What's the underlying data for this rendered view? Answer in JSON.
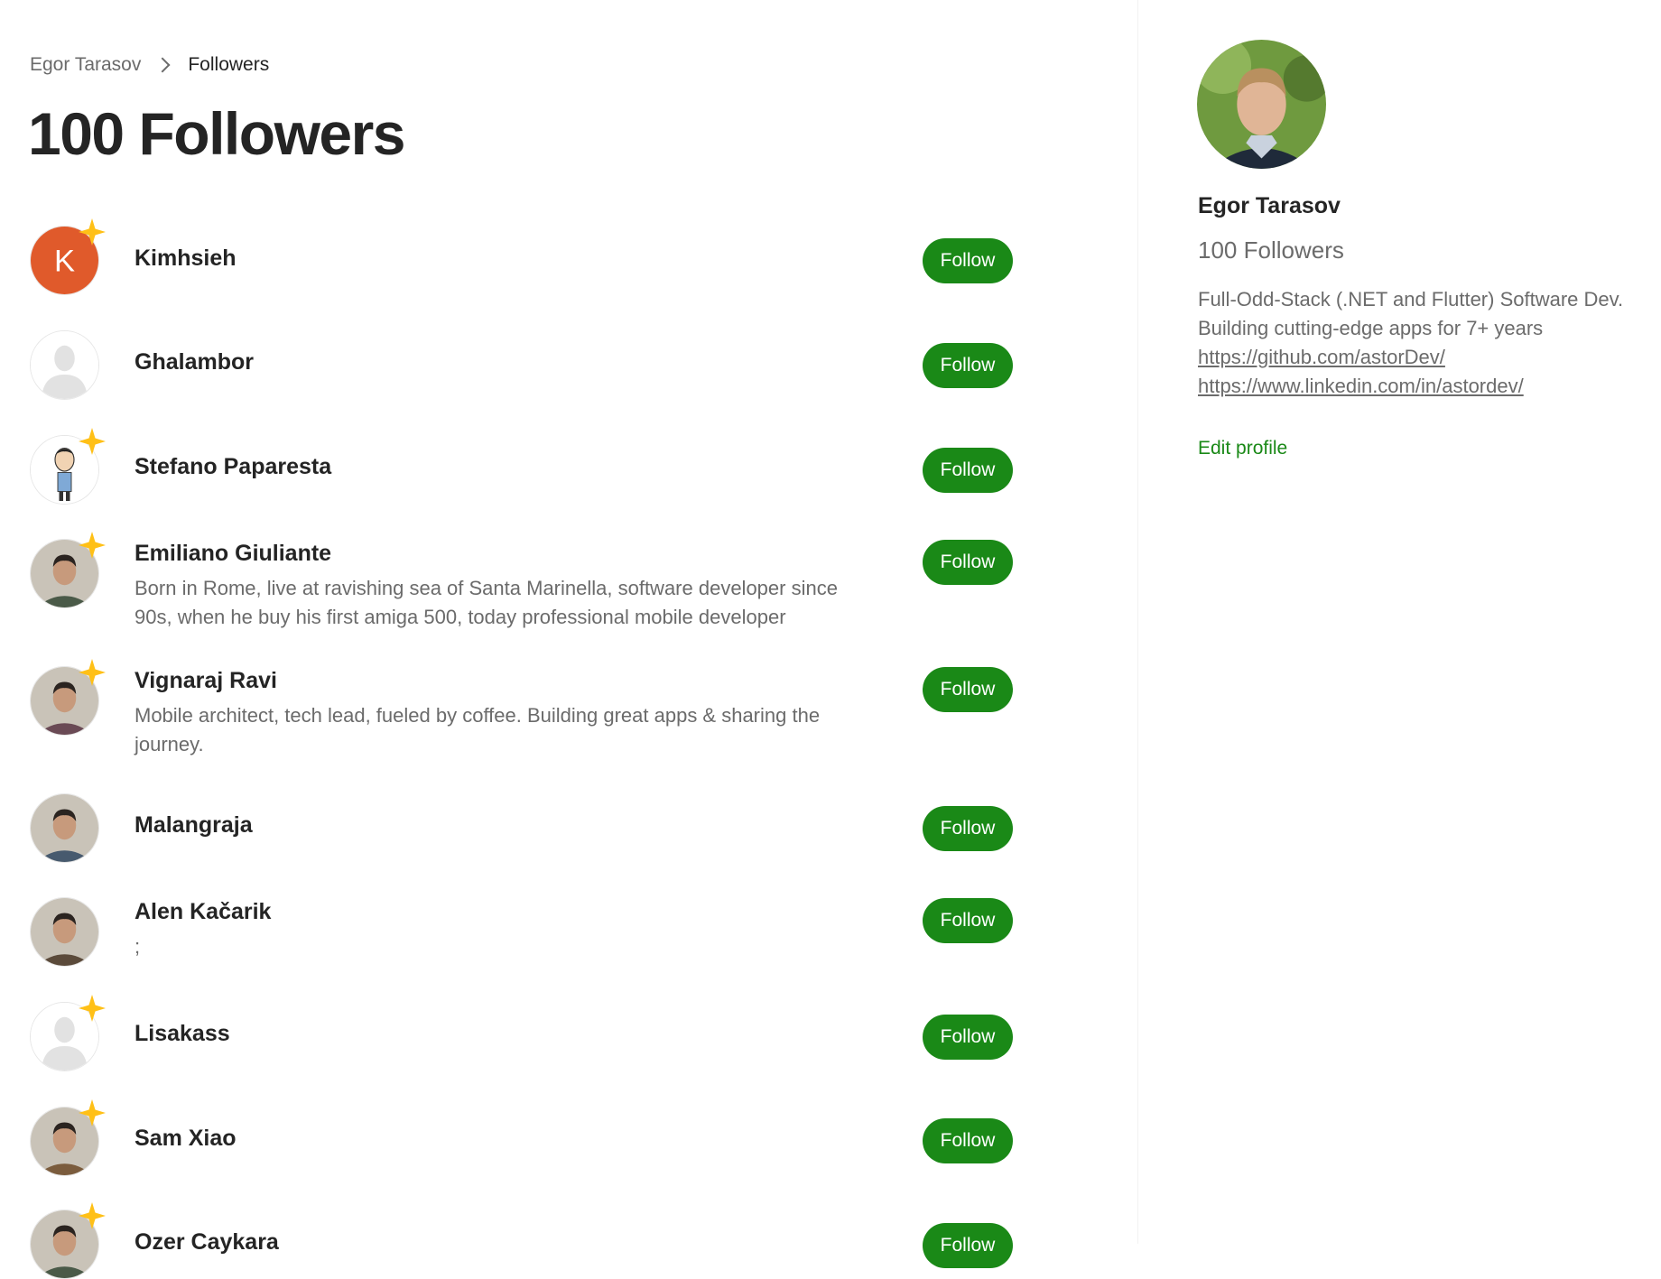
{
  "breadcrumb": {
    "parent": "Egor Tarasov",
    "current": "Followers"
  },
  "page_title": "100 Followers",
  "follow_label": "Follow",
  "followers": [
    {
      "name": "Kimhsieh",
      "bio": "",
      "avatar": "letter-avatar",
      "letter": "K",
      "avatar_color": "#e05a2b",
      "member": true
    },
    {
      "name": "Ghalambor",
      "bio": "",
      "avatar": "default-avatar",
      "member": false
    },
    {
      "name": "Stefano Paparesta",
      "bio": "",
      "avatar": "cartoon-avatar",
      "member": true
    },
    {
      "name": "Emiliano Giuliante",
      "bio": "Born in Rome, live at ravishing sea of Santa Marinella, software developer since 90s, when he buy his first amiga 500, today professional mobile developer",
      "avatar": "photo-avatar",
      "member": true
    },
    {
      "name": "Vignaraj Ravi",
      "bio": "Mobile architect, tech lead, fueled by coffee. Building great apps & sharing the journey.",
      "avatar": "photo-avatar",
      "member": true
    },
    {
      "name": "Malangraja",
      "bio": "",
      "avatar": "photo-avatar",
      "member": false
    },
    {
      "name": "Alen Kačarik",
      "bio": ";",
      "avatar": "photo-avatar",
      "member": false
    },
    {
      "name": "Lisakass",
      "bio": "",
      "avatar": "default-avatar",
      "member": true
    },
    {
      "name": "Sam Xiao",
      "bio": "",
      "avatar": "photo-avatar",
      "member": true
    },
    {
      "name": "Ozer Caykara",
      "bio": "",
      "avatar": "photo-avatar",
      "member": true
    }
  ],
  "profile": {
    "name": "Egor Tarasov",
    "followers": "100 Followers",
    "bio_line1": "Full-Odd-Stack (.NET and Flutter) Software Dev.",
    "bio_line2": "Building cutting-edge apps for 7+ years",
    "link_github": "https://github.com/astorDev/",
    "link_linkedin": "https://www.linkedin.com/in/astordev/",
    "edit_label": "Edit profile"
  },
  "colors": {
    "accent": "#1a8917",
    "member_star": "#ffc017",
    "muted_text": "#6b6b6b"
  }
}
